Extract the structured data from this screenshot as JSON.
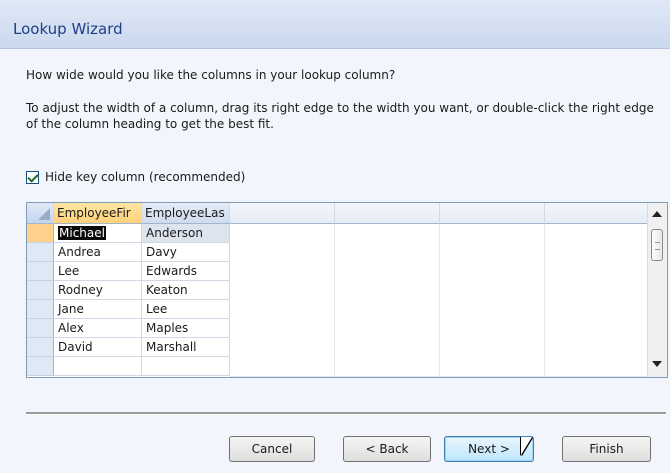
{
  "window": {
    "title": "Lookup Wizard"
  },
  "prompt": {
    "question": "How wide would you like the columns in your lookup column?",
    "instructions": "To adjust the width of a column, drag its right edge to the width you want, or double-click the right edge of the column heading to get the best fit."
  },
  "hide_key": {
    "label": "Hide key column (recommended)",
    "checked": true
  },
  "grid": {
    "headers": [
      "EmployeeFir",
      "EmployeeLas"
    ],
    "rows": [
      [
        "Michael",
        "Anderson"
      ],
      [
        "Andrea",
        "Davy"
      ],
      [
        "Lee",
        "Edwards"
      ],
      [
        "Rodney",
        "Keaton"
      ],
      [
        "Jane",
        "Lee"
      ],
      [
        "Alex",
        "Maples"
      ],
      [
        "David",
        "Marshall"
      ]
    ],
    "selected_row": 0
  },
  "buttons": {
    "cancel": "Cancel",
    "back": "< Back",
    "next": "Next >",
    "finish": "Finish"
  },
  "colors": {
    "title_text": "#1e3f87",
    "active_header": "#ffd17a",
    "accent_button": "#bee6fd"
  }
}
